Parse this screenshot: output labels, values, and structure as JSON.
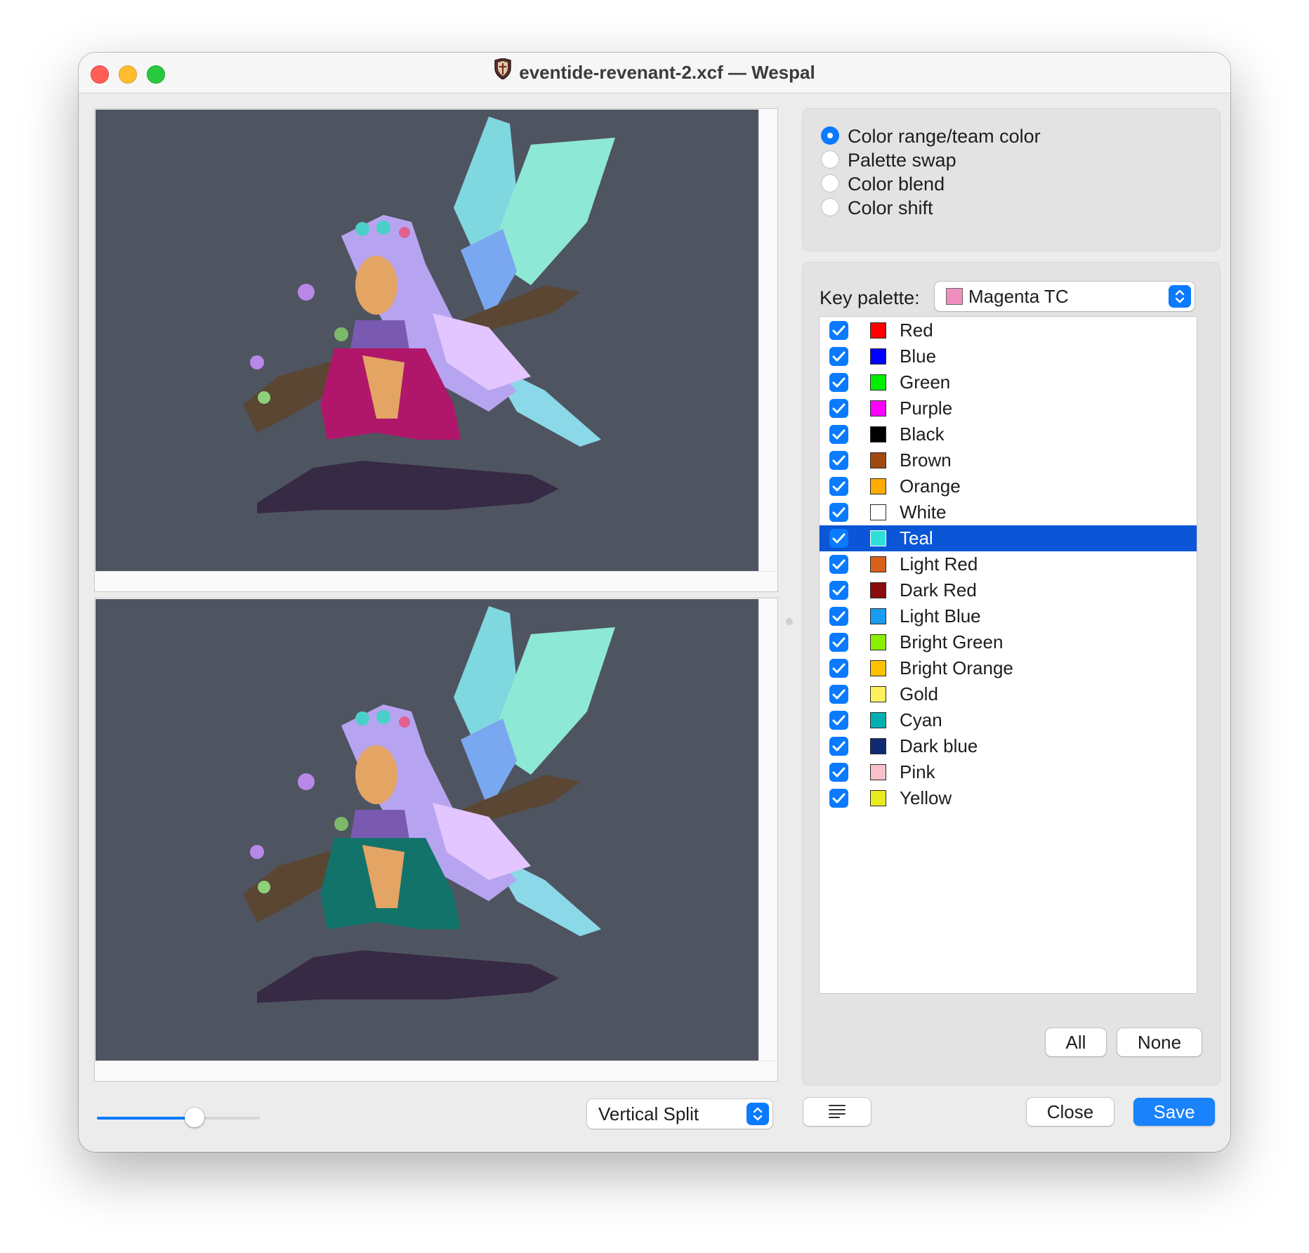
{
  "window": {
    "title": "eventide-revenant-2.xcf — Wespal",
    "app_icon": "shield-icon"
  },
  "preview": {
    "background": "#4f5461",
    "zoom_level": 0.6,
    "split_mode": "Vertical Split"
  },
  "modes": [
    {
      "label": "Color range/team color",
      "selected": true
    },
    {
      "label": "Palette swap",
      "selected": false
    },
    {
      "label": "Color blend",
      "selected": false
    },
    {
      "label": "Color shift",
      "selected": false
    }
  ],
  "key_palette": {
    "label": "Key palette:",
    "value": "Magenta TC",
    "swatch": "#f08fbd"
  },
  "color_ranges": [
    {
      "name": "Red",
      "color": "#ff0000",
      "checked": true
    },
    {
      "name": "Blue",
      "color": "#0000ff",
      "checked": true
    },
    {
      "name": "Green",
      "color": "#00ee00",
      "checked": true
    },
    {
      "name": "Purple",
      "color": "#ff00ff",
      "checked": true
    },
    {
      "name": "Black",
      "color": "#000000",
      "checked": true
    },
    {
      "name": "Brown",
      "color": "#a04a10",
      "checked": true
    },
    {
      "name": "Orange",
      "color": "#ffaa00",
      "checked": true
    },
    {
      "name": "White",
      "color": "#ffffff",
      "checked": true
    },
    {
      "name": "Teal",
      "color": "#30e0d8",
      "checked": true,
      "selected": true
    },
    {
      "name": "Light Red",
      "color": "#d86018",
      "checked": true
    },
    {
      "name": "Dark Red",
      "color": "#8a0c0c",
      "checked": true
    },
    {
      "name": "Light Blue",
      "color": "#1a9cf0",
      "checked": true
    },
    {
      "name": "Bright Green",
      "color": "#88f000",
      "checked": true
    },
    {
      "name": "Bright Orange",
      "color": "#ffc000",
      "checked": true
    },
    {
      "name": "Gold",
      "color": "#fff060",
      "checked": true
    },
    {
      "name": "Cyan",
      "color": "#00b0b0",
      "checked": true
    },
    {
      "name": "Dark blue",
      "color": "#102a72",
      "checked": true
    },
    {
      "name": "Pink",
      "color": "#f8c0c8",
      "checked": true
    },
    {
      "name": "Yellow",
      "color": "#eaea20",
      "checked": true
    }
  ],
  "buttons": {
    "all": "All",
    "none": "None",
    "log": "list-icon",
    "close": "Close",
    "save": "Save"
  },
  "colors": {
    "accent": "#0a7aff",
    "selection": "#0a56d6"
  }
}
